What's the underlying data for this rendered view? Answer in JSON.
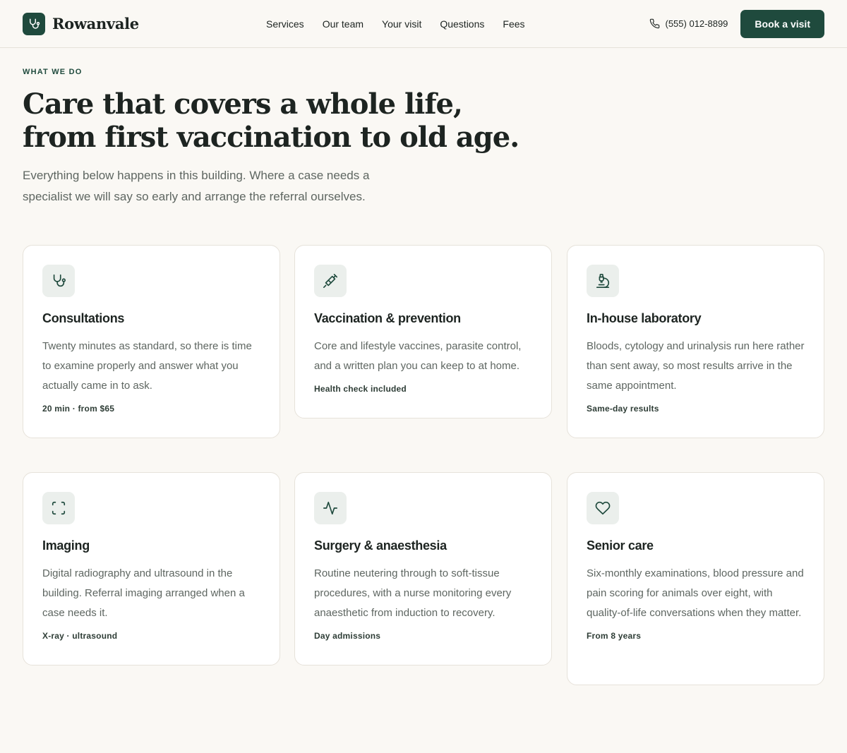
{
  "header": {
    "brand_name": "Rowanvale",
    "nav": [
      "Services",
      "Our team",
      "Your visit",
      "Questions",
      "Fees"
    ],
    "phone": "(555) 012-8899",
    "cta_label": "Book a visit"
  },
  "hero": {
    "eyebrow": "WHAT WE DO",
    "headline_line1": "Care that covers a whole life,",
    "headline_line2": "from first vaccination to old age.",
    "intro": "Everything below happens in this building. Where a case needs a specialist we will say so early and arrange the referral ourselves."
  },
  "services": [
    {
      "icon": "stethoscope-icon",
      "title": "Consultations",
      "description": "Twenty minutes as standard, so there is time to examine properly and answer what you actually came in to ask.",
      "meta": "20 min · from $65"
    },
    {
      "icon": "syringe-icon",
      "title": "Vaccination & prevention",
      "description": "Core and lifestyle vaccines, parasite control, and a written plan you can keep to at home.",
      "meta": "Health check included"
    },
    {
      "icon": "microscope-icon",
      "title": "In-house laboratory",
      "description": "Bloods, cytology and urinalysis run here rather than sent away, so most results arrive in the same appointment.",
      "meta": "Same-day results"
    },
    {
      "icon": "scan-icon",
      "title": "Imaging",
      "description": "Digital radiography and ultrasound in the building. Referral imaging arranged when a case needs it.",
      "meta": "X-ray · ultrasound"
    },
    {
      "icon": "pulse-icon",
      "title": "Surgery & anaesthesia",
      "description": "Routine neutering through to soft-tissue procedures, with a nurse monitoring every anaesthetic from induction to recovery.",
      "meta": "Day admissions"
    },
    {
      "icon": "heart-icon",
      "title": "Senior care",
      "description": "Six-monthly examinations, blood pressure and pain scoring for animals over eight, with quality-of-life conversations when they matter.",
      "meta": "From 8 years"
    }
  ],
  "colors": {
    "brand_green": "#1f4a3d",
    "background": "#faf8f4",
    "icon_tile": "#ebefec"
  }
}
